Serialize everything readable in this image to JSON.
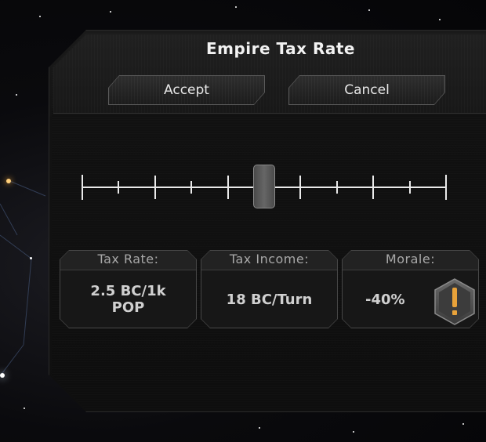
{
  "dialog": {
    "title": "Empire Tax Rate",
    "accept_label": "Accept",
    "cancel_label": "Cancel"
  },
  "slider": {
    "tick_count": 11,
    "selected_tick_index": 5,
    "selected_fraction": 0.5
  },
  "stats": {
    "tax_rate": {
      "label": "Tax Rate:",
      "value_line1": "2.5 BC/1k",
      "value_line2": "POP"
    },
    "tax_income": {
      "label": "Tax Income:",
      "value": "18 BC/Turn"
    },
    "morale": {
      "label": "Morale:",
      "value": "-40%",
      "icon": "warning-exclamation-icon"
    }
  },
  "colors": {
    "panel": "#111111",
    "text": "#f2f2f2",
    "warning_accent": "#e8a23a"
  }
}
